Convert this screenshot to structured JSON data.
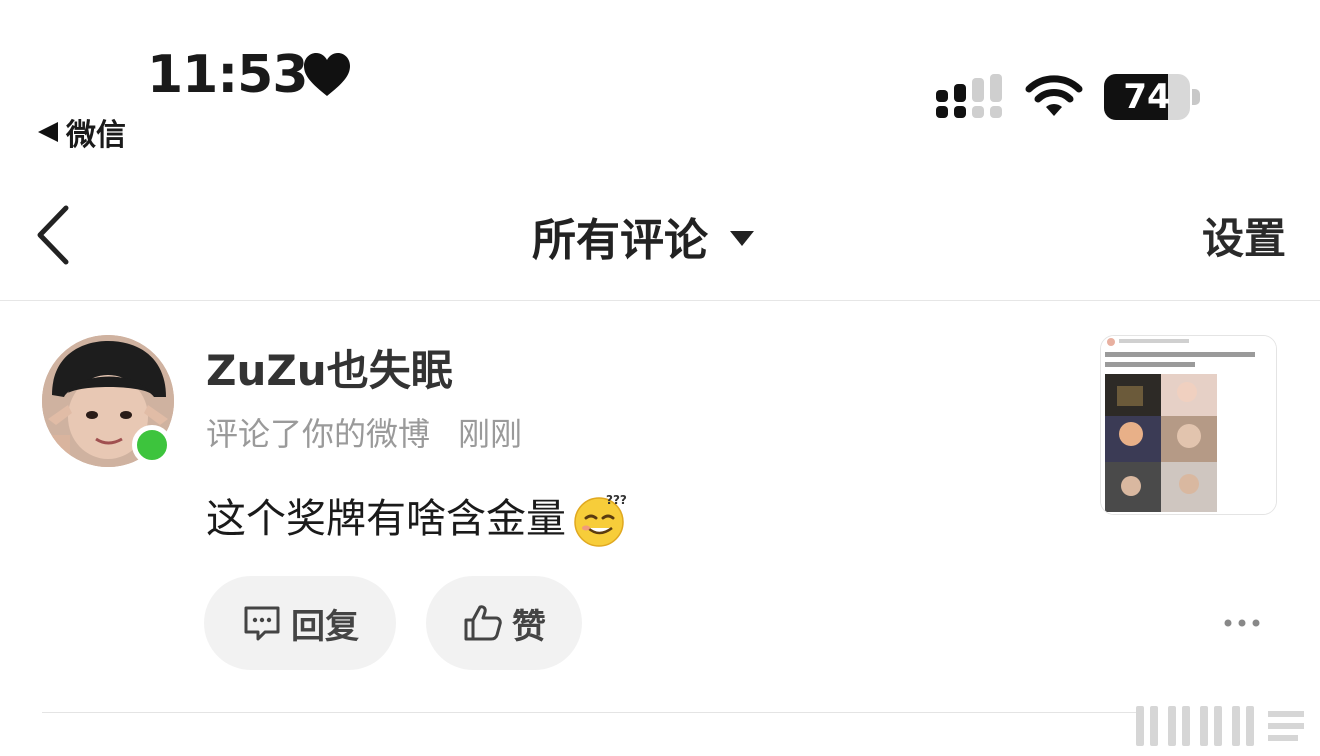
{
  "status_bar": {
    "time": "11:53",
    "back_app": "微信",
    "battery_level": "74",
    "battery_percent": 74,
    "icons": [
      "heart-icon",
      "signal-icon",
      "wifi-icon",
      "battery-icon"
    ]
  },
  "nav": {
    "title": "所有评论",
    "settings": "设置",
    "icons": [
      "chevron-left-icon",
      "caret-down-icon"
    ]
  },
  "comment": {
    "username": "ZuZu也失眠",
    "action": "评论了你的微博",
    "time": "刚刚",
    "text": "这个奖牌有啥含金量",
    "online_color": "#3dc43d",
    "actions": {
      "reply_label": "回复",
      "like_label": "赞"
    },
    "icons": [
      "avatar",
      "emoji-confused-icon",
      "comment-icon",
      "thumbs-up-icon",
      "more-icon",
      "post-thumbnail"
    ]
  }
}
